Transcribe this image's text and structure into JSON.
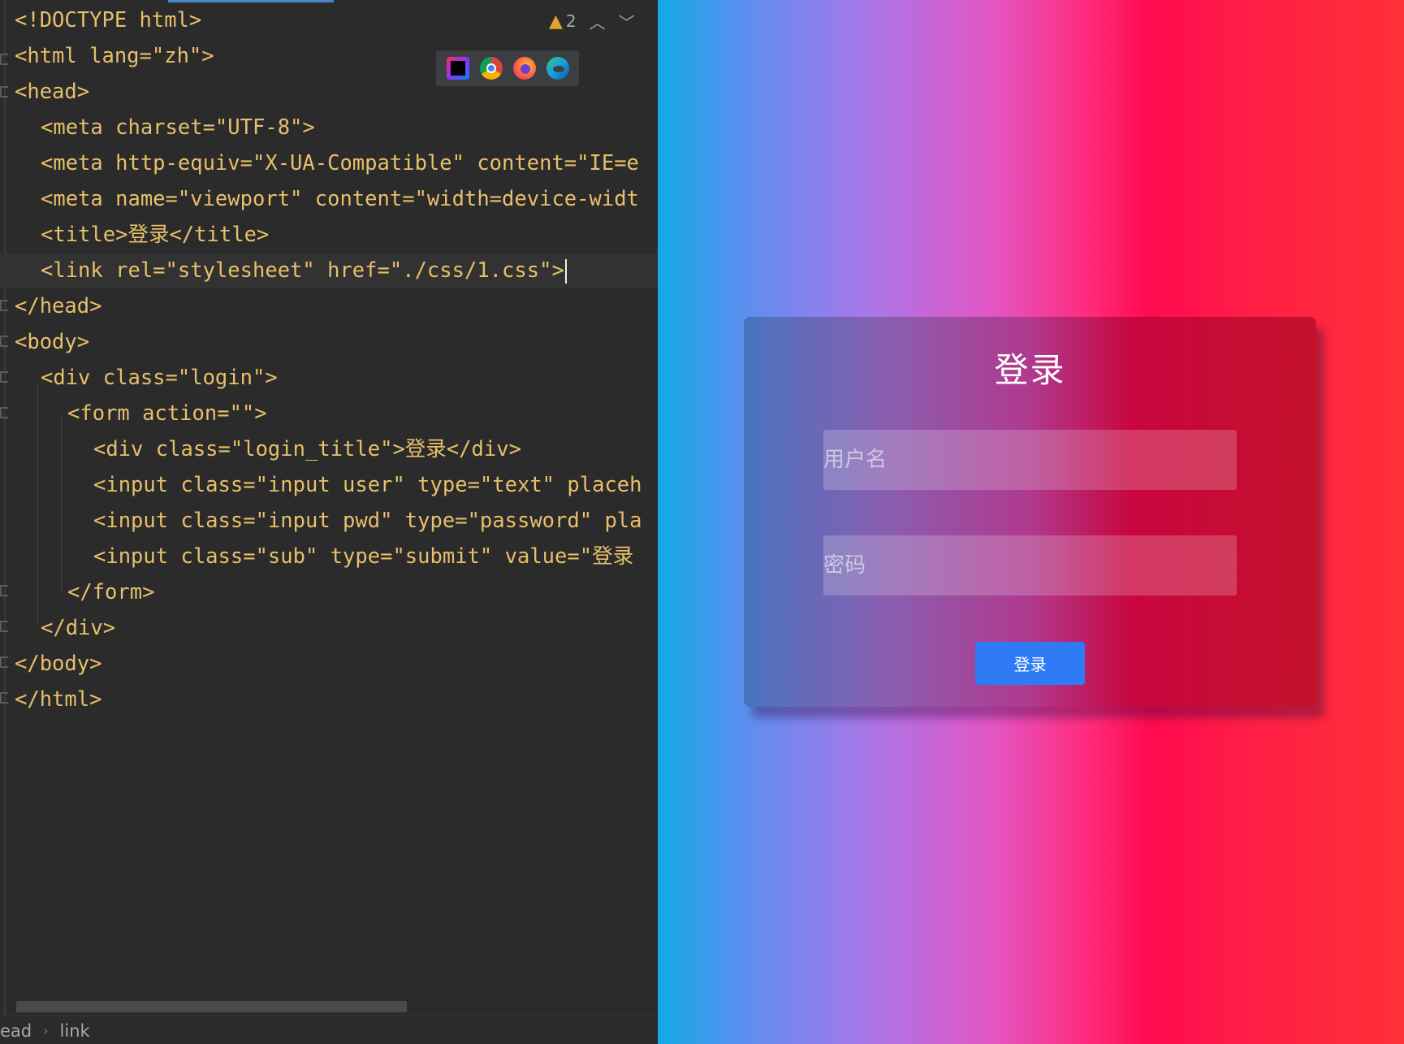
{
  "editor": {
    "warning_count": "2",
    "code_lines": [
      "<!DOCTYPE html>",
      "<html lang=\"zh\">",
      "<head>",
      "<meta charset=\"UTF-8\">",
      "<meta http-equiv=\"X-UA-Compatible\" content=\"IE=e",
      "<meta name=\"viewport\" content=\"width=device-widt",
      "<title>登录</title>",
      "<link rel=\"stylesheet\" href=\"./css/1.css\">",
      "</head>",
      "<body>",
      "<div class=\"login\">",
      "<form action=\"\">",
      "<div class=\"login_title\">登录</div>",
      "<input class=\"input user\" type=\"text\" placeh",
      "<input class=\"input pwd\" type=\"password\" pla",
      "<input class=\"sub\" type=\"submit\" value=\"登录",
      "</form>",
      "</div>",
      "</body>",
      "</html>"
    ],
    "breadcrumbs": [
      "ead",
      "link"
    ],
    "browsers": [
      "intellij-icon",
      "chrome-icon",
      "firefox-icon",
      "edge-icon"
    ]
  },
  "preview": {
    "title": "登录",
    "username_placeholder": "用户名",
    "password_placeholder": "密码",
    "submit_label": "登录"
  },
  "colors": {
    "editor_bg": "#2b2b2b",
    "tag": "#e8bf6a",
    "attr_value": "#a5c261",
    "submit_button": "#2e7bf4"
  }
}
